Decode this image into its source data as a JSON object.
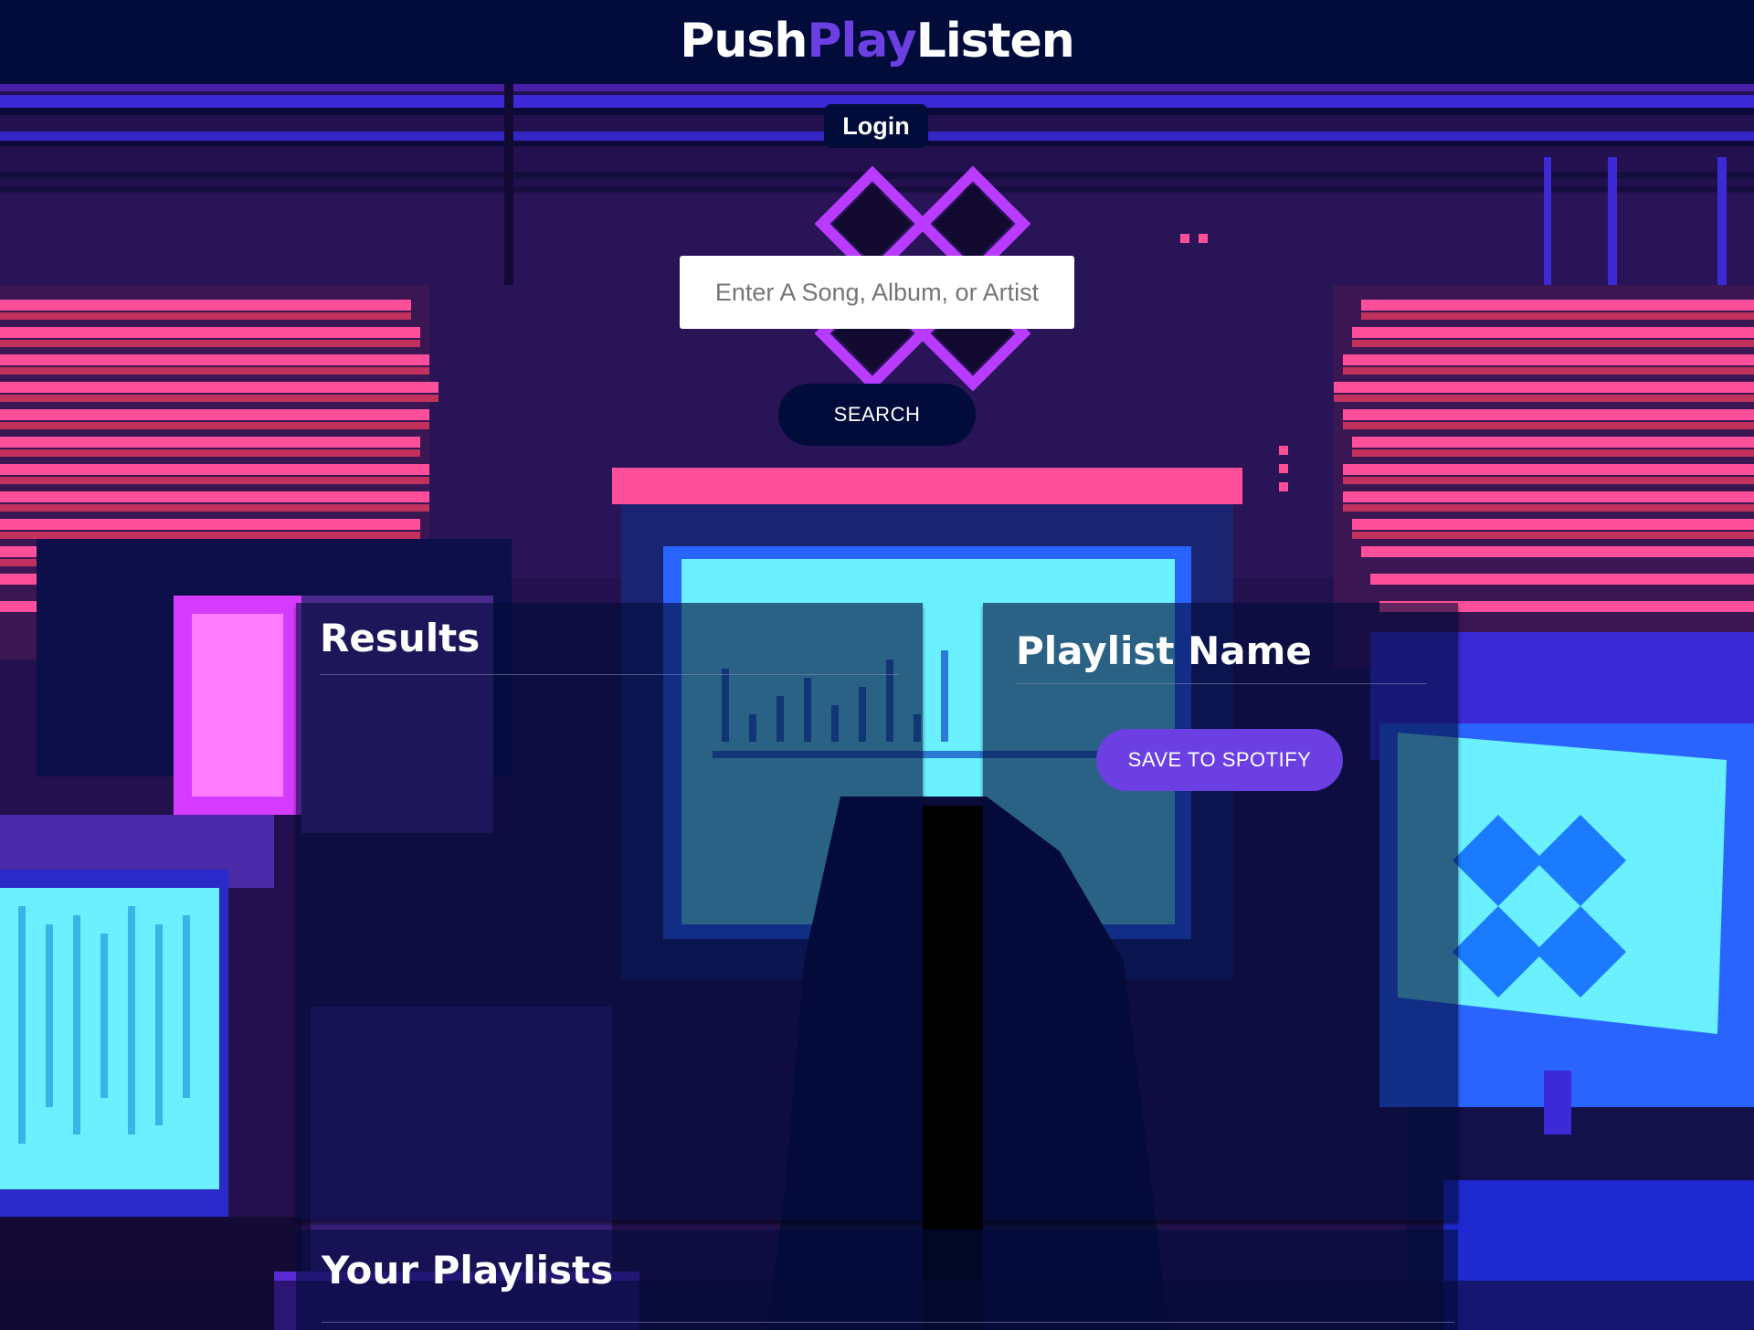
{
  "app": {
    "logo": {
      "part1": "Push",
      "part2": "Play",
      "part3": "Listen"
    }
  },
  "header": {
    "login_label": "Login"
  },
  "search": {
    "placeholder": "Enter A Song, Album, or Artist",
    "value": "",
    "button_label": "SEARCH"
  },
  "results": {
    "title": "Results"
  },
  "playlist": {
    "name": "Playlist Name",
    "save_label": "SAVE TO SPOTIFY"
  },
  "your_playlists": {
    "title": "Your Playlists"
  },
  "colors": {
    "header_bg": "#010c3a",
    "accent": "#6c3fe3",
    "neon_pink": "#ff4f9a",
    "neon_cyan": "#6af0ff",
    "neon_magenta": "#d63cff"
  },
  "background": {
    "description_icon": "pixel-art-computer-room"
  }
}
